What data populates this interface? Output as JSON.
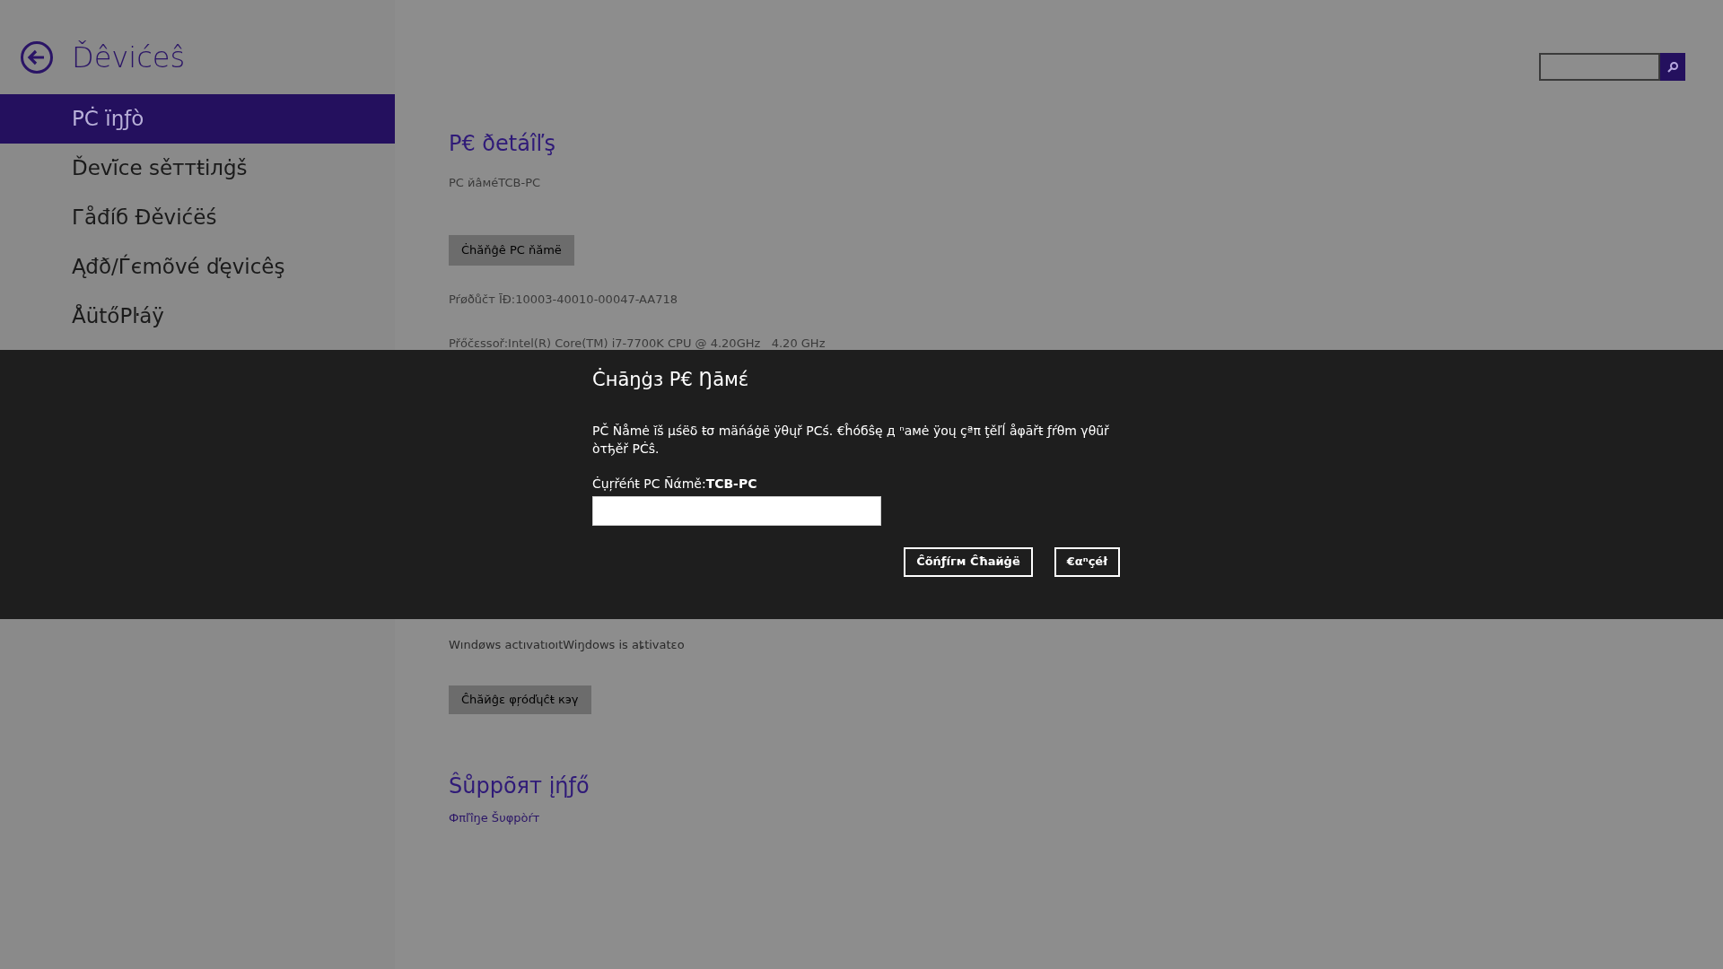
{
  "sidebar": {
    "title": "Ďêvićeŝ",
    "items": [
      {
        "label": "PĊ ïŋƒò",
        "selected": true
      },
      {
        "label": "Ďevĭ̇ce sěттŧiлġš",
        "selected": false
      },
      {
        "label": "Гåđíб Đěvićëś",
        "selected": false
      },
      {
        "label": "Ąđð/Ѓєmõvé ďęvicêş",
        "selected": false
      },
      {
        "label": "ÅütőPŀáÿ",
        "selected": false
      }
    ]
  },
  "details": {
    "heading": "P€ ðetáîľş",
    "pc_name": "PC йâмéTCB-PC",
    "change_name_button": "Ċhăňĝê PC ňămë",
    "product_id": "Pŕøðůčт ĪĐ:10003-40010-00047-AA718",
    "processor": "Přőčεssoř:Intel(R) Core(TM) i7-7700K CPU @ 4.20GHz   4.20 GHz",
    "activation": "Wındøws actıvatıoıtWiŋdows is aȶtivatɛo",
    "change_key_button": "Ĉhăйĝε φŗóďɥĉŧ кэγ"
  },
  "support": {
    "heading": "Ŝůppõят įήƒő",
    "link": "Фπľîŋe Šυφpòŕт"
  },
  "dialog": {
    "title": "Ċнāŋġз P€ Ŋāмέ",
    "message": "PČ Ňåmė ĭš μśëδ ŧσ mäńáġë ÿθųř PCś. €ĥóбŝę д ⁿамė ÿoų çªπ ţěľĺ åφāřŧ ƒŕθm γθũř òτђěř PĊŝ.",
    "current": "Ċụŗřéńŧ PC Ñάmě:**TCB-PC**",
    "buttons": [
      "Ĉõńƒíгм Ĉħaйġë",
      "€αⁿçéł"
    ]
  }
}
